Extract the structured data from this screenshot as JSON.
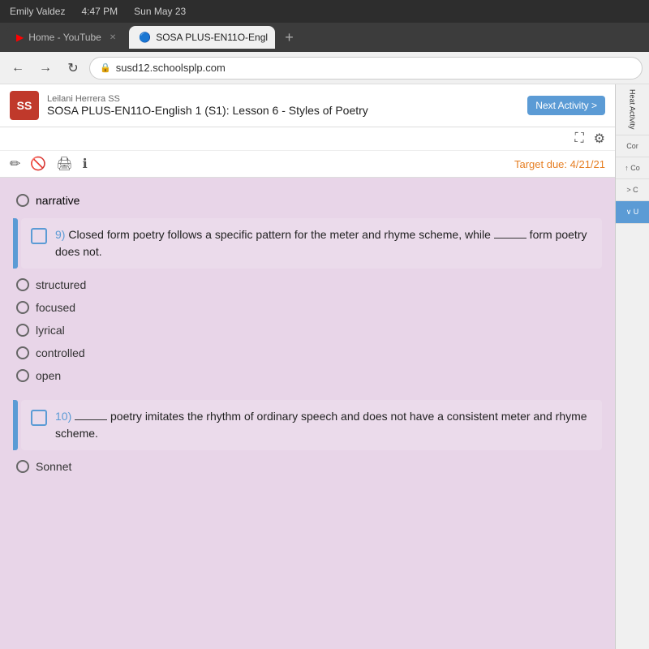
{
  "os_bar": {
    "user": "Emily Valdez",
    "time": "4:47 PM",
    "date": "Sun May 23"
  },
  "browser": {
    "tabs": [
      {
        "id": "tab-youtube",
        "label": "Home - YouTube",
        "active": false,
        "icon": "▶"
      },
      {
        "id": "tab-sosa",
        "label": "SOSA PLUS-EN11O-Engl",
        "active": true,
        "icon": "🔵"
      }
    ],
    "address": "susd12.schoolsplp.com",
    "new_tab_label": "+"
  },
  "nav": {
    "back_label": "←",
    "forward_label": "→",
    "refresh_label": "↻"
  },
  "page": {
    "school_name": "Leilani Herrera SS",
    "lesson_title": "SOSA PLUS-EN11O-English 1 (S1): Lesson 6 - Styles of Poetry",
    "next_activity_label": "Next Activity >",
    "target_due": "Target due: 4/21/21",
    "icons": {
      "expand": "⛶",
      "settings": "⚙",
      "edit": "✏",
      "ban": "🚫",
      "print": "🖨",
      "info": "ℹ"
    }
  },
  "right_panel": {
    "heat_activity": "Heat Activity",
    "cor_label": "Cor",
    "sections": [
      "↑ Co",
      "> C",
      "∨ U"
    ]
  },
  "quiz": {
    "previous_answer": "narrative",
    "questions": [
      {
        "number": "9)",
        "text": "Closed form poetry follows a specific pattern for the meter and rhyme scheme, while _____ form poetry does not.",
        "options": [
          "structured",
          "focused",
          "lyrical",
          "controlled",
          "open"
        ]
      },
      {
        "number": "10)",
        "text": "_____ poetry imitates the rhythm of ordinary speech and does not have a consistent meter and rhyme scheme.",
        "options": [
          "Sonnet"
        ]
      }
    ]
  }
}
